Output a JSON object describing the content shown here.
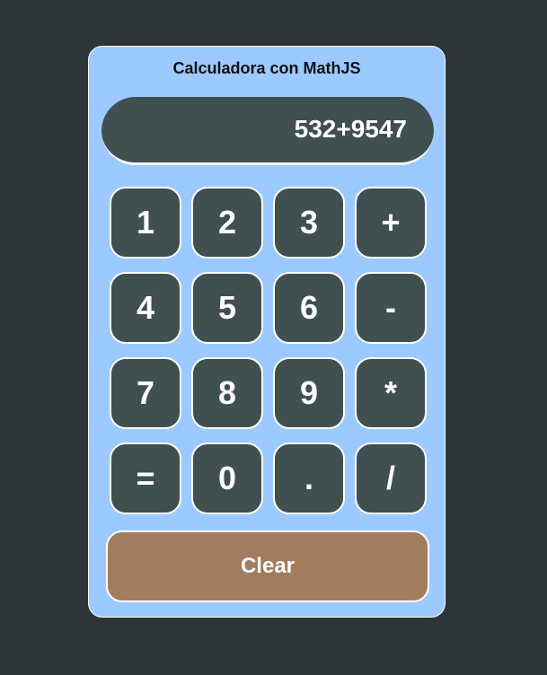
{
  "app": {
    "title": "Calculadora con MathJS"
  },
  "display": {
    "value": "532+9547"
  },
  "keypad": {
    "rows": [
      [
        "1",
        "2",
        "3",
        "+"
      ],
      [
        "4",
        "5",
        "6",
        "-"
      ],
      [
        "7",
        "8",
        "9",
        "*"
      ],
      [
        "=",
        "0",
        ".",
        "/"
      ]
    ]
  },
  "actions": {
    "clear_label": "Clear"
  },
  "colors": {
    "page_background": "#2e3539",
    "card_background": "#9cc9ff",
    "key_background": "#404f4f",
    "clear_background": "#a37b5f",
    "text_light": "#ffffff"
  }
}
